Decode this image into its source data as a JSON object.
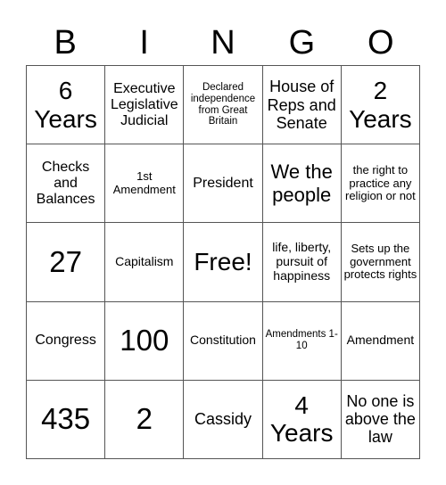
{
  "card": {
    "header_letters": [
      "B",
      "I",
      "N",
      "G",
      "O"
    ],
    "rows": [
      [
        "6 Years",
        "Executive Legislative Judicial",
        "Declared independence from Great Britain",
        "House of Reps and Senate",
        "2 Years"
      ],
      [
        "Checks and Balances",
        "1st Amendment",
        "President",
        "We the people",
        "the right to practice any religion or not"
      ],
      [
        "27",
        "Capitalism",
        "Free!",
        "life, liberty, pursuit of happiness",
        "Sets up the government protects rights"
      ],
      [
        "Congress",
        "100",
        "Constitution",
        "Amendments 1-10",
        "Amendment"
      ],
      [
        "435",
        "2",
        "Cassidy",
        "4 Years",
        "No one is above the law"
      ]
    ],
    "free_space_label": "Free!"
  }
}
